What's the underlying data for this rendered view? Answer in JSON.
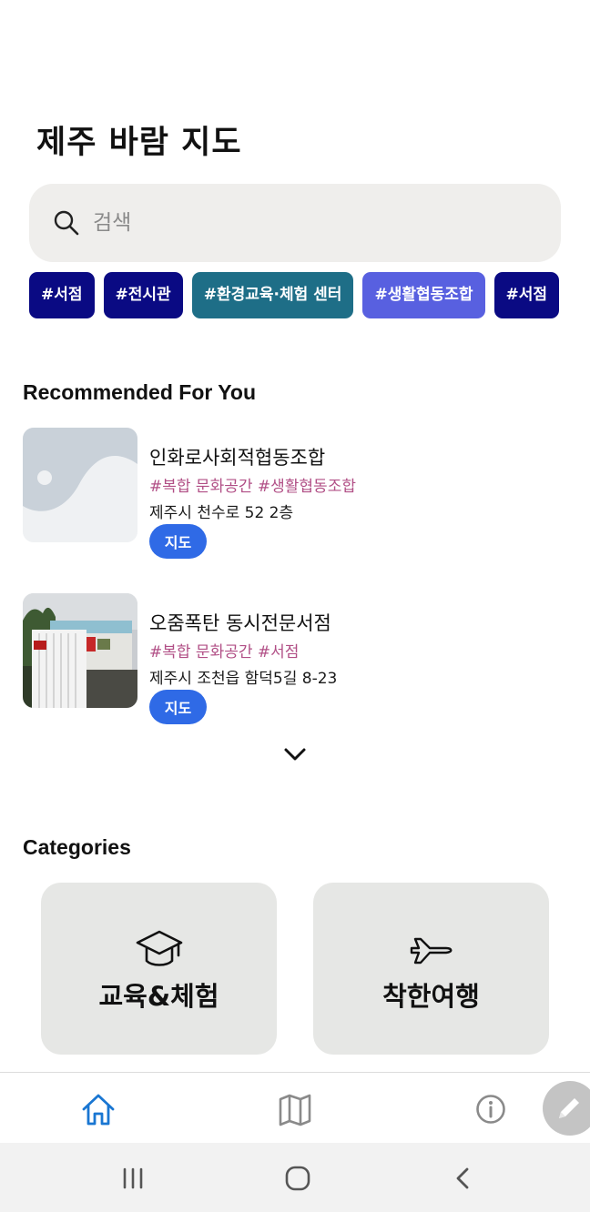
{
  "app": {
    "title": "제주 바람 지도"
  },
  "search": {
    "placeholder": "검색",
    "value": ""
  },
  "tags": [
    {
      "label": "#서점",
      "color": "#0a0a83"
    },
    {
      "label": "#전시관",
      "color": "#0a0a83"
    },
    {
      "label": "#환경교육·체험 센터",
      "color": "#1e6e87"
    },
    {
      "label": "#생활협동조합",
      "color": "#5860e0"
    },
    {
      "label": "#서점",
      "color": "#0a0a83"
    }
  ],
  "recommended": {
    "title": "Recommended For You",
    "items": [
      {
        "name": "인화로사회적협동조합",
        "tags": "#복합 문화공간 #생활협동조합",
        "address": "제주시 천수로 52 2층",
        "button": "지도",
        "image": "placeholder-image"
      },
      {
        "name": "오줌폭탄 동시전문서점",
        "tags": "#복합 문화공간 #서점",
        "address": "제주시 조천읍 함덕5길 8-23",
        "button": "지도",
        "image": "bookstore-photo"
      }
    ],
    "expand_icon": "chevron-down-icon"
  },
  "categories": {
    "title": "Categories",
    "items": [
      {
        "label": "교육&체험",
        "icon": "graduation-cap-icon"
      },
      {
        "label": "착한여행",
        "icon": "airplane-icon"
      }
    ]
  },
  "bottom_nav": {
    "items": [
      {
        "icon": "home-icon",
        "active": true,
        "color": "#1976d2"
      },
      {
        "icon": "map-icon",
        "active": false,
        "color": "#8a8a8a"
      },
      {
        "icon": "info-icon",
        "active": false,
        "color": "#8a8a8a"
      }
    ],
    "fab_icon": "pencil-icon"
  },
  "system_nav": {
    "items": [
      "recent-apps-icon",
      "home-circle-icon",
      "back-icon"
    ]
  }
}
